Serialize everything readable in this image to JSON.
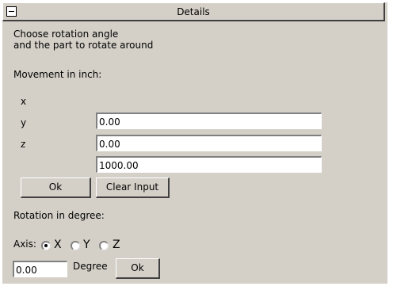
{
  "panel": {
    "title": "Details",
    "intro_line1": "Choose rotation angle",
    "intro_line2": "and the part to rotate around"
  },
  "movement": {
    "heading": "Movement in inch:",
    "fields": [
      {
        "label": "x",
        "value": "0.00"
      },
      {
        "label": "y",
        "value": "0.00"
      },
      {
        "label": "z",
        "value": "1000.00"
      }
    ],
    "ok_label": "Ok",
    "clear_label": "Clear Input"
  },
  "rotation": {
    "heading": "Rotation in degree:",
    "axis_label": "Axis:",
    "axes": [
      {
        "label": "X",
        "selected": true
      },
      {
        "label": "Y",
        "selected": false
      },
      {
        "label": "Z",
        "selected": false
      }
    ],
    "degree_value": "0.00",
    "degree_label": "Degree",
    "ok_label": "Ok"
  }
}
